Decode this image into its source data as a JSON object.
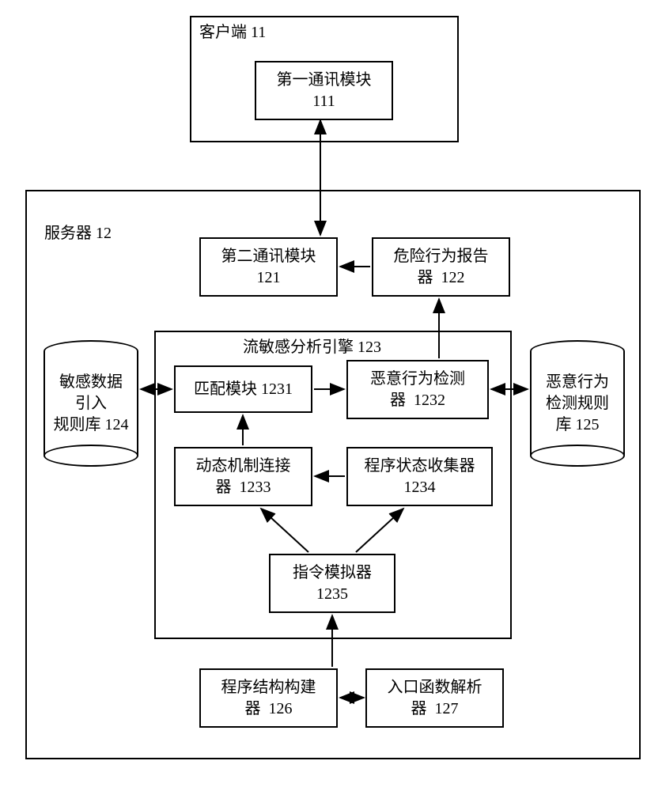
{
  "client": {
    "title": "客户端  11",
    "comm1": "第一通讯模块\n111"
  },
  "server": {
    "title": "服务器  12",
    "comm2": "第二通讯模块\n121",
    "reporter": "危险行为报告\n器  122",
    "engine_title": "流敏感分析引擎  123",
    "match": "匹配模块  1231",
    "detector": "恶意行为检测\n器  1232",
    "linker": "动态机制连接\n器  1233",
    "collector": "程序状态收集器\n1234",
    "simulator": "指令模拟器\n1235",
    "builder": "程序结构构建\n器  126",
    "parser": "入口函数解析\n器  127",
    "db_left": "敏感数据\n引入\n规则库 124",
    "db_right": "恶意行为\n检测规则\n库 125"
  }
}
